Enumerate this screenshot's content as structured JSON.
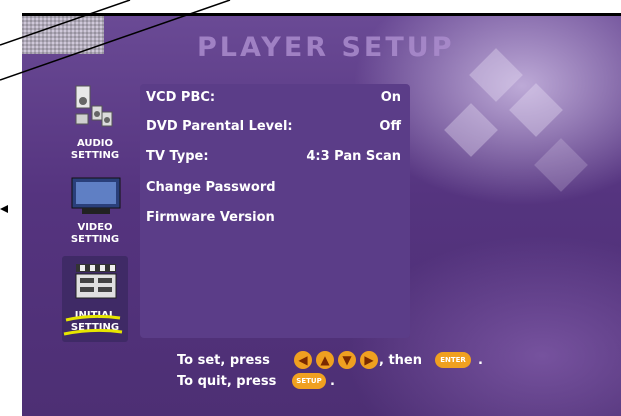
{
  "title": "PLAYER SETUP",
  "sidebar": {
    "items": [
      {
        "label_line1": "AUDIO",
        "label_line2": "SETTING"
      },
      {
        "label_line1": "VIDEO",
        "label_line2": "SETTING"
      },
      {
        "label_line1": "INITIAL",
        "label_line2": "SETTING"
      }
    ]
  },
  "menu": {
    "items": [
      {
        "label": "VCD PBC:",
        "value": "On"
      },
      {
        "label": "DVD Parental Level:",
        "value": "Off"
      },
      {
        "label": "TV Type:",
        "value": "4:3 Pan Scan"
      },
      {
        "label": "Change Password",
        "value": ""
      },
      {
        "label": "Firmware Version",
        "value": ""
      }
    ]
  },
  "footer": {
    "set_prefix": "To set, press",
    "set_suffix": ", then",
    "enter_label": "ENTER",
    "set_end": ".",
    "quit_prefix": "To quit, press",
    "setup_label": "SETUP",
    "quit_end": "."
  },
  "icons": [
    "left-arrow-icon",
    "up-arrow-icon",
    "down-arrow-icon",
    "right-arrow-icon"
  ],
  "colors": {
    "accent": "#f0a020",
    "highlight": "#e6e600",
    "background": "#55347f"
  }
}
